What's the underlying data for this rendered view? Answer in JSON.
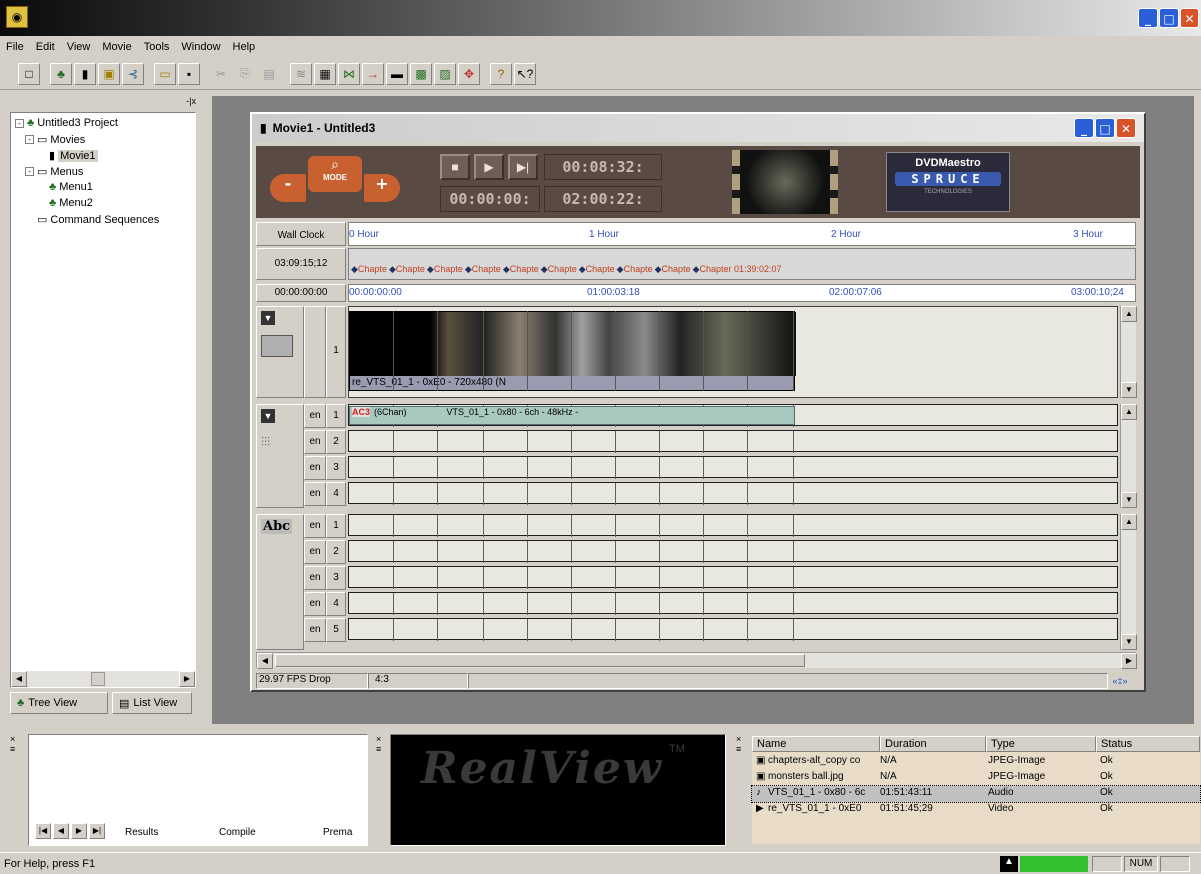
{
  "window": {
    "icon": "app-icon"
  },
  "menu": [
    "File",
    "Edit",
    "View",
    "Movie",
    "Tools",
    "Window",
    "Help"
  ],
  "toolbar": {
    "icons": [
      "new-icon",
      "project-icon",
      "movie-icon",
      "menu-icon",
      "branch-icon",
      "open-icon",
      "save-icon",
      "cut-icon",
      "copy-icon",
      "paste-icon",
      "chapter-icon",
      "grid-icon",
      "link-icon",
      "jump-icon",
      "render-icon",
      "compile-icon",
      "burn-icon",
      "move-icon",
      "help-icon",
      "context-help-icon"
    ]
  },
  "tree": {
    "items": [
      {
        "label": "Untitled3 Project",
        "level": 0,
        "icon": "project-icon"
      },
      {
        "label": "Movies",
        "level": 1,
        "icon": "folder-icon"
      },
      {
        "label": "Movie1",
        "level": 2,
        "icon": "movie-icon",
        "selected": true
      },
      {
        "label": "Menus",
        "level": 1,
        "icon": "folder-icon"
      },
      {
        "label": "Menu1",
        "level": 2,
        "icon": "menu-icon"
      },
      {
        "label": "Menu2",
        "level": 2,
        "icon": "menu-icon"
      },
      {
        "label": "Command Sequences",
        "level": 1,
        "icon": "folder-icon"
      }
    ],
    "tabs": [
      "Tree View",
      "List View"
    ]
  },
  "movie_window": {
    "title": "Movie1 - Untitled3",
    "mode_label": "MODE",
    "timecodes": {
      "top": "00:08:32:",
      "current": "00:00:00:",
      "duration": "02:00:22:"
    },
    "brand": {
      "line1": "DVDMaestro",
      "line2": "SPRUCE",
      "line3": "TECHNOLOGIES"
    },
    "wall_clock_label": "Wall Clock",
    "hour_ticks": [
      "0 Hour",
      "1 Hour",
      "2 Hour",
      "3 Hour"
    ],
    "chapter_time": "03:09:15;12",
    "chapters": [
      "Chapte",
      "Chapte",
      "Chapte",
      "Chapte",
      "Chapte",
      "Chapte",
      "Chapte",
      "Chapte",
      "Chapte",
      "Chapter 01:39:02:07"
    ],
    "timeline_start": "00:00:00:00",
    "timecode_ticks": [
      "00:00:00:00",
      "01:00:03:18",
      "02:00:07:06",
      "03:00:10;24"
    ],
    "video_track": {
      "num": "1",
      "clip_label": "re_VTS_01_1 - 0xE0 - 720x480 (N"
    },
    "audio_tracks": [
      {
        "lang": "en",
        "num": "1",
        "clip": {
          "format": "AC3",
          "chan": "(6Chan)",
          "name": "VTS_01_1 - 0x80 - 6ch - 48kHz -"
        }
      },
      {
        "lang": "en",
        "num": "2"
      },
      {
        "lang": "en",
        "num": "3"
      },
      {
        "lang": "en",
        "num": "4"
      }
    ],
    "subtitle_label": "Abc",
    "subtitle_tracks": [
      {
        "lang": "en",
        "num": "1"
      },
      {
        "lang": "en",
        "num": "2"
      },
      {
        "lang": "en",
        "num": "3"
      },
      {
        "lang": "en",
        "num": "4"
      },
      {
        "lang": "en",
        "num": "5"
      }
    ],
    "status_fps": "29.97 FPS Drop",
    "status_aspect": "4:3"
  },
  "results_panel": {
    "tabs": [
      "Results",
      "Compile",
      "Prema"
    ]
  },
  "realview": {
    "text": "RealView",
    "tm": "TM"
  },
  "file_list": {
    "headers": [
      "Name",
      "Duration",
      "Type",
      "Status"
    ],
    "rows": [
      {
        "name": "chapters-alt_copy co",
        "duration": "N/A",
        "type": "JPEG-Image",
        "status": "Ok",
        "icon": "image-icon"
      },
      {
        "name": "monsters ball.jpg",
        "duration": "N/A",
        "type": "JPEG-Image",
        "status": "Ok",
        "icon": "image-icon"
      },
      {
        "name": "VTS_01_1 - 0x80 - 6c",
        "duration": "01:51:43:11",
        "type": "Audio",
        "status": "Ok",
        "icon": "audio-icon",
        "selected": true
      },
      {
        "name": "re_VTS_01_1 - 0xE0",
        "duration": "01:51:45;29",
        "type": "Video",
        "status": "Ok",
        "icon": "video-icon"
      }
    ]
  },
  "statusbar": {
    "help": "For Help, press F1",
    "num": "NUM"
  }
}
